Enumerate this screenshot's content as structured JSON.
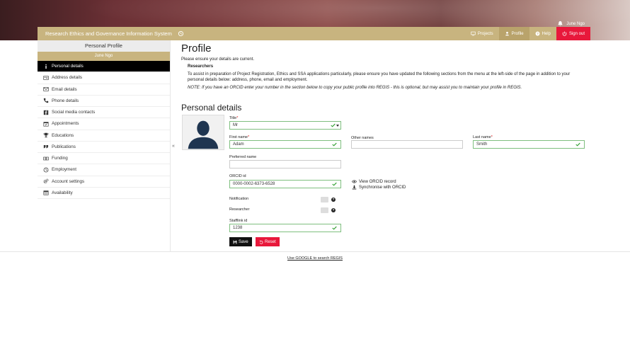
{
  "header": {
    "user_name": "June Ngo",
    "brand": "Research Ethics and Governance Information System",
    "nav": [
      {
        "label": "Projects",
        "icon": "monitor-icon"
      },
      {
        "label": "Profile",
        "icon": "users-icon"
      },
      {
        "label": "Help",
        "icon": "question-icon"
      },
      {
        "label": "Sign out",
        "icon": "power-icon"
      }
    ],
    "colors": {
      "brand": "#c8b47f",
      "signout": "#e8183b"
    }
  },
  "sidebar": {
    "title": "Personal Profile",
    "user": "June Ngo",
    "collapse_symbol": "«",
    "items": [
      {
        "label": "Personal details",
        "icon": "info-icon"
      },
      {
        "label": "Address details",
        "icon": "address-card-icon"
      },
      {
        "label": "Email details",
        "icon": "envelope-icon"
      },
      {
        "label": "Phone details",
        "icon": "phone-icon"
      },
      {
        "label": "Social media contacts",
        "icon": "facebook-icon"
      },
      {
        "label": "Appointments",
        "icon": "calendar-icon"
      },
      {
        "label": "Educations",
        "icon": "trophy-icon"
      },
      {
        "label": "Publications",
        "icon": "quote-icon"
      },
      {
        "label": "Funding",
        "icon": "money-icon"
      },
      {
        "label": "Employment",
        "icon": "clock-icon"
      },
      {
        "label": "Account settings",
        "icon": "cogs-icon"
      },
      {
        "label": "Availability",
        "icon": "calendar-grid-icon"
      }
    ]
  },
  "main": {
    "title": "Profile",
    "intro": "Please ensure your details are current.",
    "researchers_title": "Researchers",
    "researchers_text": "To assist in preparation of Project Registration, Ethics and SSA applications particularly, please ensure you have updated the following sections from the menu at the left-side of the page in addition to your personal details below: address, phone, email and employment.",
    "note": "NOTE: If you have an ORCID enter your number in the section below to copy your public profile into REGIS - this is optional, but may assist you to maintain your profile in REGIS.",
    "section_title": "Personal details",
    "required_mark": "*",
    "form": {
      "title_label": "Title",
      "title_value": "Mr",
      "first_name_label": "First name",
      "first_name_value": "Adam",
      "other_names_label": "Other names",
      "other_names_value": "",
      "last_name_label": "Last name",
      "last_name_value": "Smith",
      "preferred_label": "Preferred name",
      "preferred_value": "",
      "orcid_label": "ORCID id",
      "orcid_value": "0000-0002-6373-6528",
      "view_orcid": "View ORCID record",
      "sync_orcid": "Synchronise with ORCID",
      "notification_label": "Notification",
      "researcher_label": "Researcher",
      "help_mark": "?",
      "stafflink_label": "Stafflink id",
      "stafflink_value": "1238",
      "save_label": "Save",
      "reset_label": "Reset"
    }
  },
  "footer": {
    "link": "Use GOOGLE to search REGIS"
  }
}
